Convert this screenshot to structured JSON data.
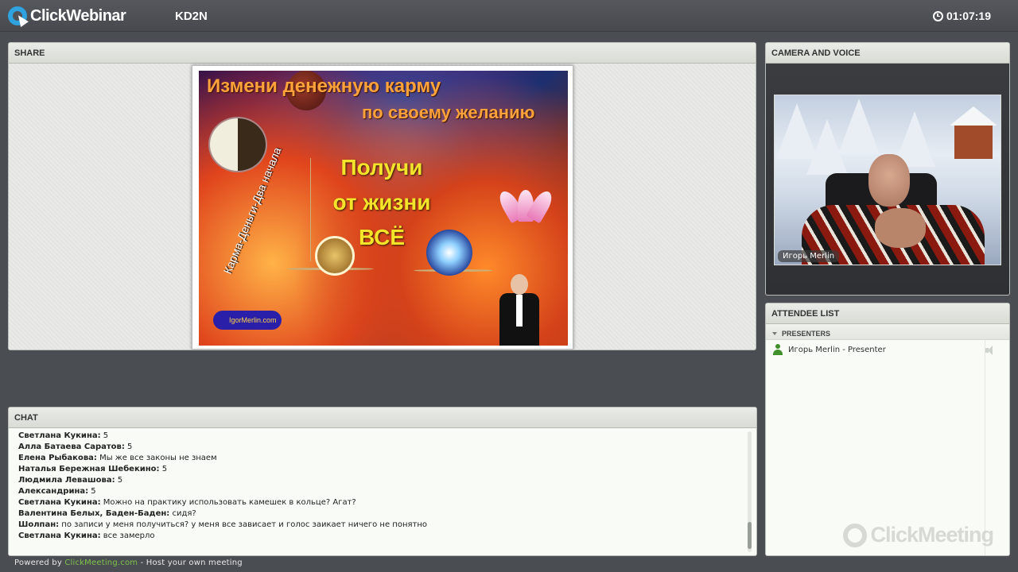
{
  "header": {
    "brand": "ClickWebinar",
    "meeting_code": "KD2N",
    "timer": "01:07:19"
  },
  "share": {
    "title": "SHARE",
    "slide": {
      "line1": "Измени денежную карму",
      "line2": "по своему желанию",
      "main": "Получи от жизни ВСЁ",
      "vertical": "Карма-Деньги-Два начала",
      "badge": "IgorMerlin.com"
    }
  },
  "chat": {
    "title": "CHAT",
    "messages": [
      {
        "author": "Светлана Кукина:",
        "text": " 5"
      },
      {
        "author": "Алла Батаева Саратов:",
        "text": " 5"
      },
      {
        "author": "Елена Рыбакова:",
        "text": " Мы же все законы не знаем"
      },
      {
        "author": "Наталья Бережная Шебекино:",
        "text": " 5"
      },
      {
        "author": "Людмила Левашова:",
        "text": " 5"
      },
      {
        "author": "Александрина:",
        "text": " 5"
      },
      {
        "author": "Светлана Кукина:",
        "text": " Можно на практику использовать камешек в кольце? Агат?"
      },
      {
        "author": "Валентина Белых, Баден-Баден:",
        "text": " сидя?"
      },
      {
        "author": "Шолпан:",
        "text": " по записи у меня получиться? у меня все зависает и голос заикает ничего не понятно"
      },
      {
        "author": "Светлана Кукина:",
        "text": " все замерло"
      }
    ]
  },
  "footer": {
    "prefix": "Powered by ",
    "link": "ClickMeeting.com",
    "suffix": " - Host your own meeting"
  },
  "camera": {
    "title": "CAMERA AND VOICE",
    "video_label": "Игорь Merlin"
  },
  "attendees": {
    "title": "ATTENDEE LIST",
    "group": "PRESENTERS",
    "list": [
      {
        "name": "Игорь Merlin - Presenter"
      }
    ]
  },
  "watermark": "ClickMeeting",
  "colors": {
    "brand_blue": "#2ea3e0",
    "link_green": "#7fc24a",
    "presenter_green": "#3f8f2a",
    "background": "#4a4d52"
  }
}
